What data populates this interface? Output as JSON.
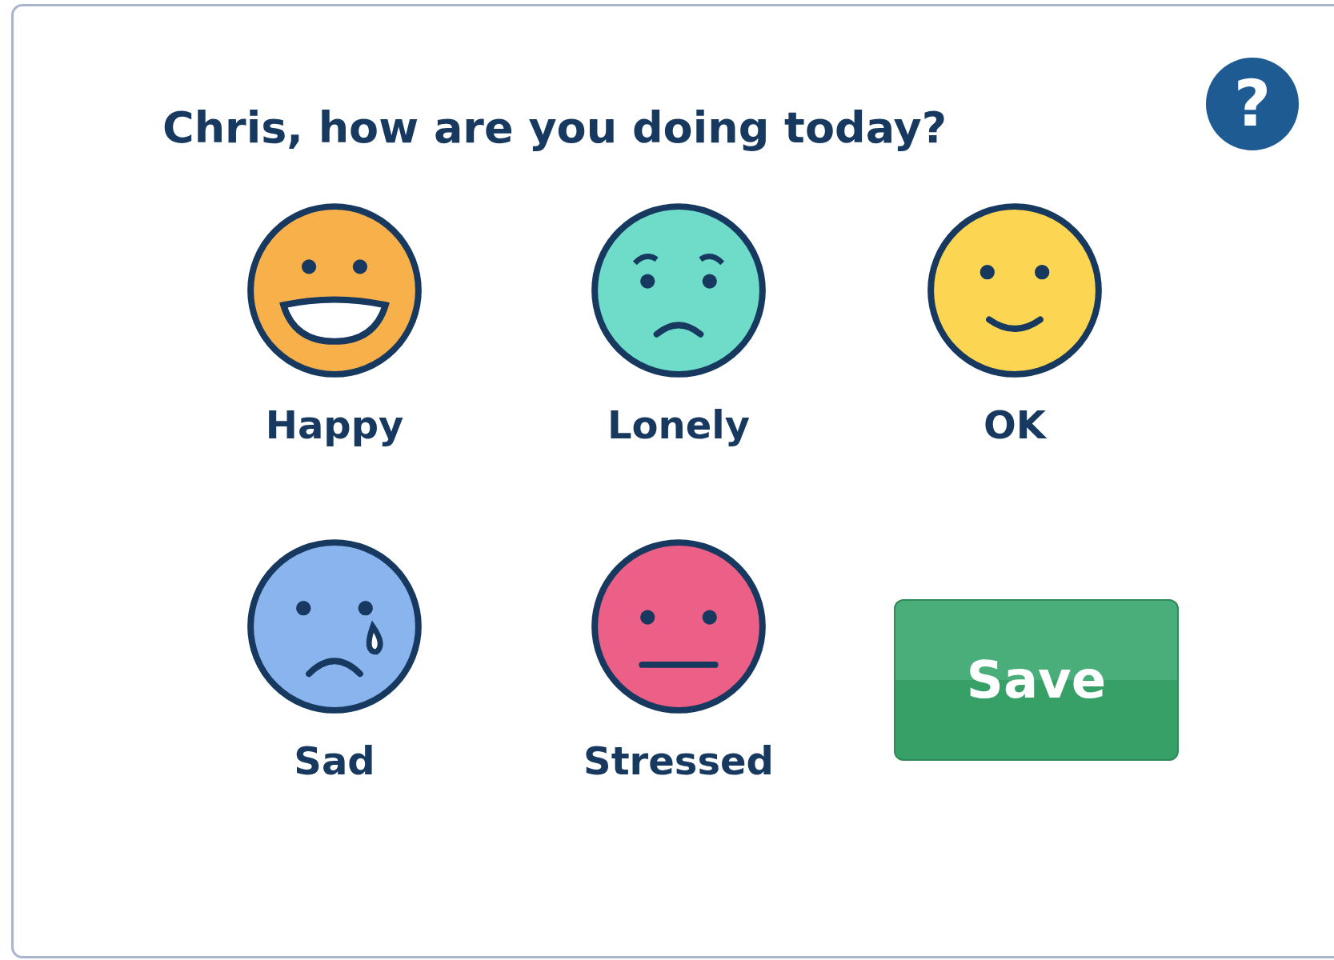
{
  "title": "Chris, how are you doing today?",
  "help": {
    "label": "?"
  },
  "moods": [
    {
      "label": "Happy",
      "kind": "grin",
      "color": "#f8b04a",
      "selected": false
    },
    {
      "label": "Lonely",
      "kind": "worried",
      "color": "#6fdcc9",
      "selected": false
    },
    {
      "label": "OK",
      "kind": "smile",
      "color": "#fcd552",
      "selected": false
    },
    {
      "label": "Sad",
      "kind": "crying",
      "color": "#8ab4ee",
      "selected": false
    },
    {
      "label": "Stressed",
      "kind": "neutral",
      "color": "#ec5f86",
      "selected": false
    }
  ],
  "save_button": "Save"
}
